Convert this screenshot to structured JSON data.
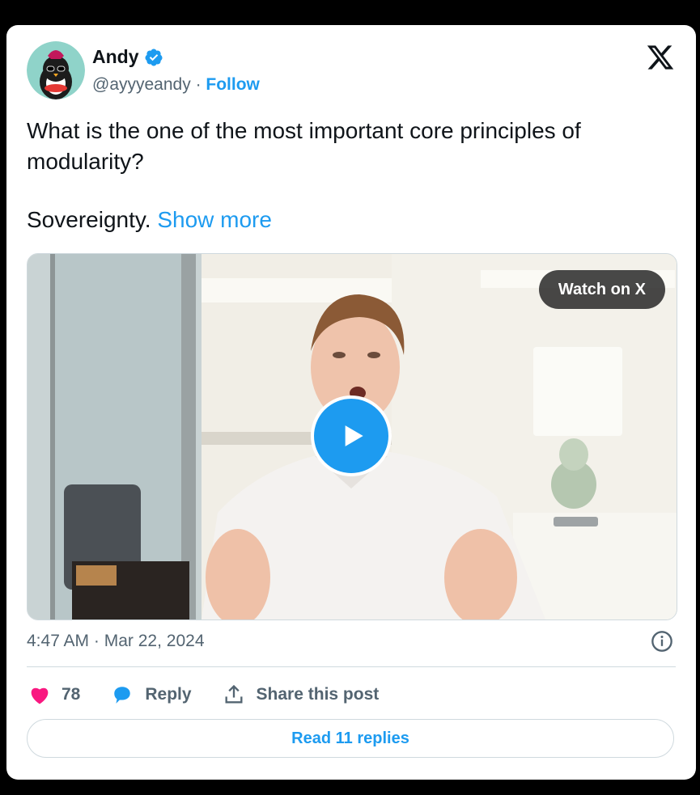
{
  "author": {
    "name": "Andy",
    "handle": "@ayyyeandy",
    "separator": "·",
    "follow_label": "Follow"
  },
  "tweet": {
    "line1": "What is the one of the most important core principles of modularity?",
    "line2": "Sovereignty.",
    "show_more": "Show more"
  },
  "media": {
    "watch_label": "Watch on X",
    "play_icon": "play-icon"
  },
  "meta": {
    "time": "4:47 AM",
    "separator": "·",
    "date": "Mar 22, 2024"
  },
  "actions": {
    "likes": "78",
    "reply_label": "Reply",
    "share_label": "Share this post"
  },
  "replies_button": "Read 11 replies",
  "colors": {
    "accent": "#1d9bf0",
    "like": "#f91880",
    "text": "#0f1419",
    "muted": "#536471"
  }
}
